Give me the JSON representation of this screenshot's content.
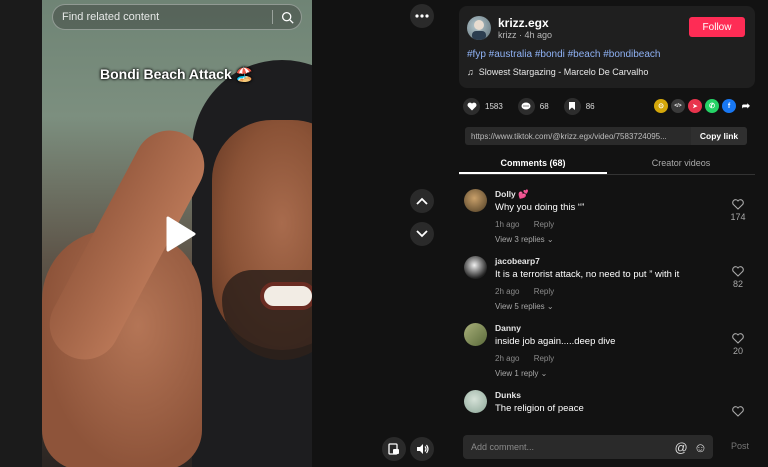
{
  "search": {
    "placeholder": "Find related content"
  },
  "video": {
    "caption": "Bondi Beach Attack 🏖️"
  },
  "author": {
    "username": "krizz.egx",
    "meta": "krizz · 4h ago",
    "follow_label": "Follow"
  },
  "post": {
    "hashtags": "#fyp #australia #bondi #beach #bondibeach",
    "music": "Slowest Stargazing - Marcelo De Carvalho"
  },
  "stats": {
    "likes": "1583",
    "comments": "68",
    "saves": "86"
  },
  "share_icons": [
    {
      "name": "embed",
      "color": "#d4a70a",
      "glyph": "⊙"
    },
    {
      "name": "code",
      "color": "#3a3a3a",
      "glyph": "</>"
    },
    {
      "name": "send",
      "color": "#e8344d",
      "glyph": "➤"
    },
    {
      "name": "whatsapp",
      "color": "#25d366",
      "glyph": "✆"
    },
    {
      "name": "facebook",
      "color": "#1877f2",
      "glyph": "f"
    }
  ],
  "link": {
    "url": "https://www.tiktok.com/@krizz.egx/video/7583724095...",
    "copy_label": "Copy link"
  },
  "tabs": [
    {
      "label": "Comments (68)"
    },
    {
      "label": "Creator videos"
    }
  ],
  "comments": [
    {
      "name": "Dolly 💕",
      "text": "Why you doing this “”",
      "time": "1h ago",
      "reply": "Reply",
      "replies": "View 3 replies ⌄",
      "likes": "174",
      "avatar_color": "#6b5a3a"
    },
    {
      "name": "jacobearp7",
      "text": "It is a terrorist attack, no need to put ” with it",
      "time": "2h ago",
      "reply": "Reply",
      "replies": "View 5 replies ⌄",
      "likes": "82",
      "avatar_color": "#4a4a4a"
    },
    {
      "name": "Danny",
      "text": "inside job again.....deep dive",
      "time": "2h ago",
      "reply": "Reply",
      "replies": "View 1 reply ⌄",
      "likes": "20",
      "avatar_color": "#7b8a5a"
    },
    {
      "name": "Dunks",
      "text": "The religion of peace",
      "time": "",
      "reply": "",
      "replies": "",
      "likes": "",
      "avatar_color": "#9fb3a6"
    }
  ],
  "composer": {
    "placeholder": "Add comment...",
    "post_label": "Post"
  }
}
